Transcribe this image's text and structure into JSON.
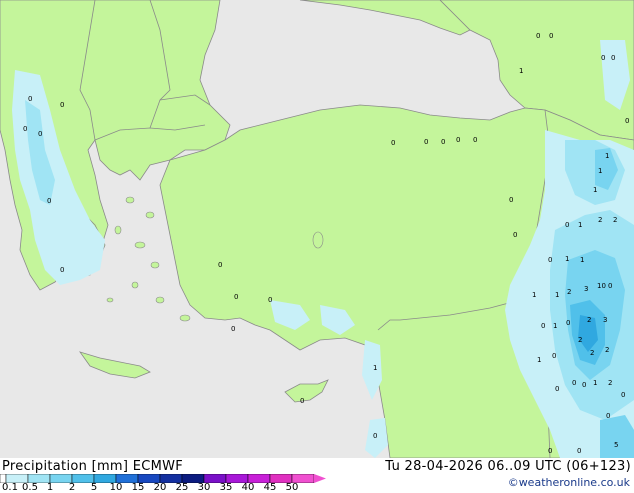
{
  "header": {
    "product": "Precipitation [mm]",
    "model": "ECMWF",
    "valid": "Tu 28-04-2026 06..09 UTC (06+123)"
  },
  "credit": "©weatheronline.co.uk",
  "legend": {
    "ticks": [
      "0.1",
      "0.5",
      "1",
      "2",
      "5",
      "10",
      "15",
      "20",
      "25",
      "30",
      "35",
      "40",
      "45",
      "50"
    ],
    "colors": [
      "#c8f0f8",
      "#a0e4f4",
      "#78d4f0",
      "#50c0ea",
      "#30a8e0",
      "#2070d8",
      "#1848c0",
      "#1430a0",
      "#0c1c80",
      "#7a10c8",
      "#a818d8",
      "#c820d8",
      "#e030c0",
      "#f050d0"
    ]
  },
  "map": {
    "colors": {
      "land": "#c4f59b",
      "sea": "#e8e8e8",
      "border": "#8a8a8a"
    },
    "values": [
      "0",
      "0",
      "1",
      "0",
      "0",
      "0",
      "0",
      "0",
      "0",
      "0",
      "0",
      "0",
      "0",
      "0",
      "0",
      "0",
      "0",
      "0",
      "0",
      "0",
      "0",
      "0",
      "0",
      "0",
      "1",
      "1",
      "1",
      "2",
      "2",
      "1",
      "0",
      "1",
      "0",
      "0",
      "1",
      "1",
      "1",
      "2",
      "3",
      "10",
      "0",
      "0",
      "1",
      "0",
      "2",
      "3",
      "2",
      "1",
      "2",
      "0",
      "2",
      "1",
      "0",
      "2",
      "0",
      "1",
      "0",
      "0",
      "5",
      "0",
      "0",
      "0"
    ]
  }
}
